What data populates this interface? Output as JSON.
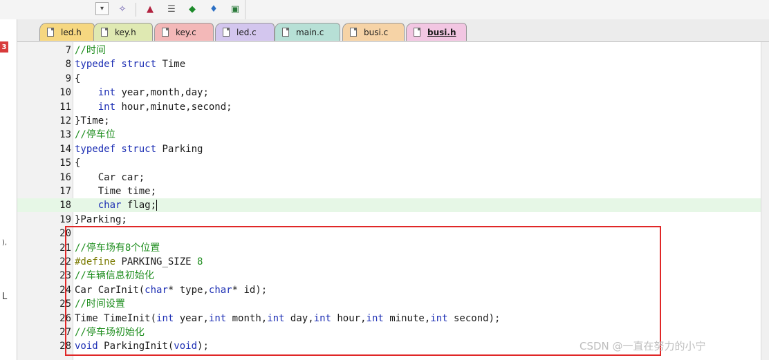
{
  "tabs": [
    {
      "label": "led.h",
      "color": "#f6d780",
      "active": false
    },
    {
      "label": "key.h",
      "color": "#dfe9b2",
      "active": false
    },
    {
      "label": "key.c",
      "color": "#f3b8b8",
      "active": false
    },
    {
      "label": "led.c",
      "color": "#d3c6ee",
      "active": false
    },
    {
      "label": "main.c",
      "color": "#b7e0d6",
      "active": false
    },
    {
      "label": "busi.c",
      "color": "#f6d3a6",
      "active": false
    },
    {
      "label": "busi.h",
      "color": "#f2c6e2",
      "active": true
    }
  ],
  "left_strip": {
    "marker": "3",
    "glyph_1": "),",
    "glyph_2": "L"
  },
  "editor": {
    "current_line": 18,
    "lines": [
      {
        "n": "7",
        "tokens": [
          {
            "t": "//时间",
            "c": "cm"
          }
        ]
      },
      {
        "n": "8",
        "tokens": [
          {
            "t": "typedef struct",
            "c": "kw"
          },
          {
            "t": " Time",
            "c": "id"
          }
        ]
      },
      {
        "n": "9",
        "tokens": [
          {
            "t": "{",
            "c": "id"
          }
        ]
      },
      {
        "n": "10",
        "tokens": [
          {
            "t": "    ",
            "c": "id"
          },
          {
            "t": "int",
            "c": "kw"
          },
          {
            "t": " year,month,day;",
            "c": "id"
          }
        ]
      },
      {
        "n": "11",
        "tokens": [
          {
            "t": "    ",
            "c": "id"
          },
          {
            "t": "int",
            "c": "kw"
          },
          {
            "t": " hour,minute,second;",
            "c": "id"
          }
        ]
      },
      {
        "n": "12",
        "tokens": [
          {
            "t": "}Time;",
            "c": "id"
          }
        ]
      },
      {
        "n": "13",
        "tokens": [
          {
            "t": "//停车位",
            "c": "cm"
          }
        ]
      },
      {
        "n": "14",
        "tokens": [
          {
            "t": "typedef struct",
            "c": "kw"
          },
          {
            "t": " Parking",
            "c": "id"
          }
        ]
      },
      {
        "n": "15",
        "tokens": [
          {
            "t": "{",
            "c": "id"
          }
        ]
      },
      {
        "n": "16",
        "tokens": [
          {
            "t": "    Car car;",
            "c": "id"
          }
        ]
      },
      {
        "n": "17",
        "tokens": [
          {
            "t": "    Time time;",
            "c": "id"
          }
        ]
      },
      {
        "n": "18",
        "tokens": [
          {
            "t": "    ",
            "c": "id"
          },
          {
            "t": "char",
            "c": "kw"
          },
          {
            "t": " flag;",
            "c": "id"
          }
        ]
      },
      {
        "n": "19",
        "tokens": [
          {
            "t": "}Parking;",
            "c": "id"
          }
        ]
      },
      {
        "n": "20",
        "tokens": []
      },
      {
        "n": "21",
        "tokens": [
          {
            "t": "//停车场有8个位置",
            "c": "cm"
          }
        ]
      },
      {
        "n": "22",
        "tokens": [
          {
            "t": "#define",
            "c": "pp"
          },
          {
            "t": " PARKING_SIZE ",
            "c": "id"
          },
          {
            "t": "8",
            "c": "num"
          }
        ]
      },
      {
        "n": "23",
        "tokens": [
          {
            "t": "//车辆信息初始化",
            "c": "cm"
          }
        ]
      },
      {
        "n": "24",
        "tokens": [
          {
            "t": "Car CarInit(",
            "c": "id"
          },
          {
            "t": "char",
            "c": "kw"
          },
          {
            "t": "* type,",
            "c": "id"
          },
          {
            "t": "char",
            "c": "kw"
          },
          {
            "t": "* id);",
            "c": "id"
          }
        ]
      },
      {
        "n": "25",
        "tokens": [
          {
            "t": "//时间设置",
            "c": "cm"
          }
        ]
      },
      {
        "n": "26",
        "tokens": [
          {
            "t": "Time TimeInit(",
            "c": "id"
          },
          {
            "t": "int",
            "c": "kw"
          },
          {
            "t": " year,",
            "c": "id"
          },
          {
            "t": "int",
            "c": "kw"
          },
          {
            "t": " month,",
            "c": "id"
          },
          {
            "t": "int",
            "c": "kw"
          },
          {
            "t": " day,",
            "c": "id"
          },
          {
            "t": "int",
            "c": "kw"
          },
          {
            "t": " hour,",
            "c": "id"
          },
          {
            "t": "int",
            "c": "kw"
          },
          {
            "t": " minute,",
            "c": "id"
          },
          {
            "t": "int",
            "c": "kw"
          },
          {
            "t": " second);",
            "c": "id"
          }
        ]
      },
      {
        "n": "27",
        "tokens": [
          {
            "t": "//停车场初始化",
            "c": "cm"
          }
        ]
      },
      {
        "n": "28",
        "tokens": [
          {
            "t": "void",
            "c": "kw"
          },
          {
            "t": " ParkingInit(",
            "c": "id"
          },
          {
            "t": "void",
            "c": "kw"
          },
          {
            "t": ");",
            "c": "id"
          }
        ]
      }
    ]
  },
  "watermark": "CSDN @一直在努力的小宁",
  "colors": {
    "keyword": "#1d2fb4",
    "comment": "#1f8e1f",
    "preprocessor": "#7a7a00",
    "current_line": "#e6f7e6",
    "highlight_box": "#e02727"
  }
}
